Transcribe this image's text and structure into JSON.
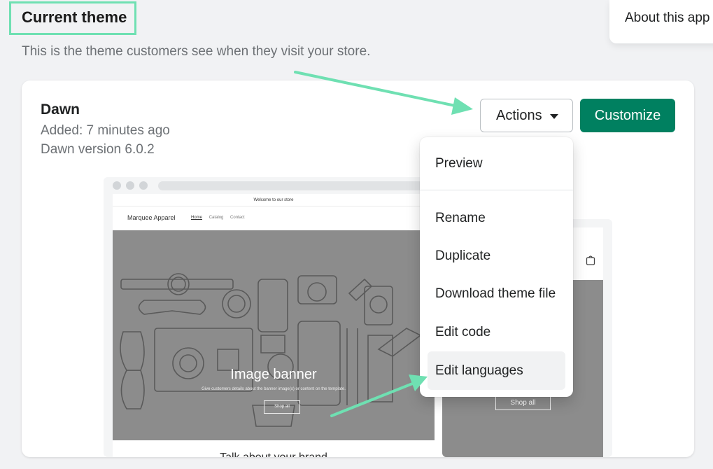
{
  "header": {
    "title": "Current theme",
    "subtitle": "This is the theme customers see when they visit your store."
  },
  "about": {
    "label": "About this app"
  },
  "theme": {
    "name": "Dawn",
    "added": "Added: 7 minutes ago",
    "version": "Dawn version 6.0.2"
  },
  "buttons": {
    "actions": "Actions",
    "customize": "Customize"
  },
  "menu": {
    "items": [
      "Preview",
      "Rename",
      "Duplicate",
      "Download theme file",
      "Edit code",
      "Edit languages"
    ]
  },
  "preview": {
    "announcement": "Welcome to our store",
    "brand": "Marquee Apparel",
    "nav": [
      "Home",
      "Catalog",
      "Contact"
    ],
    "banner_title": "Image banner",
    "banner_sub": "Give customers details about the banner image(s) or content on the template.",
    "shop_all": "Shop all",
    "footer_text": "Talk about your brand",
    "mobile_shop_all": "Shop all"
  },
  "colors": {
    "primary": "#008060",
    "highlight": "#6fe0b2",
    "background": "#f1f2f4"
  }
}
